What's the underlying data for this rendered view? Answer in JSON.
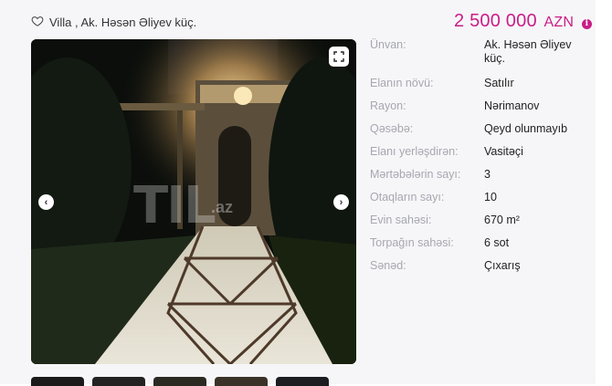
{
  "listing": {
    "title": "Villa , Ak. Həsən Əliyev küç.",
    "price": "2 500 000",
    "currency": "AZN",
    "info_icon": "info-icon"
  },
  "gallery": {
    "watermark": "TIL",
    "watermark_suffix": ".az",
    "thumbnail_count": 5
  },
  "details": [
    {
      "label": "Ünvan:",
      "value": "Ak. Həsən Əliyev küç."
    },
    {
      "label": "Elanın növü:",
      "value": "Satılır"
    },
    {
      "label": "Rayon:",
      "value": "Nərimanov"
    },
    {
      "label": "Qəsəbə:",
      "value": "Qeyd olunmayıb"
    },
    {
      "label": "Elanı yerləşdirən:",
      "value": "Vasitəçi"
    },
    {
      "label": "Mərtəbələrin sayı:",
      "value": "3"
    },
    {
      "label": "Otaqların sayı:",
      "value": "10"
    },
    {
      "label": "Evin sahəsi:",
      "value": "670 m²"
    },
    {
      "label": "Torpağın sahəsi:",
      "value": "6 sot"
    },
    {
      "label": "Sənəd:",
      "value": "Çıxarış"
    }
  ],
  "colors": {
    "accent": "#ca1d87",
    "label": "#a7a7b1",
    "panel": "#f6f6f8"
  }
}
